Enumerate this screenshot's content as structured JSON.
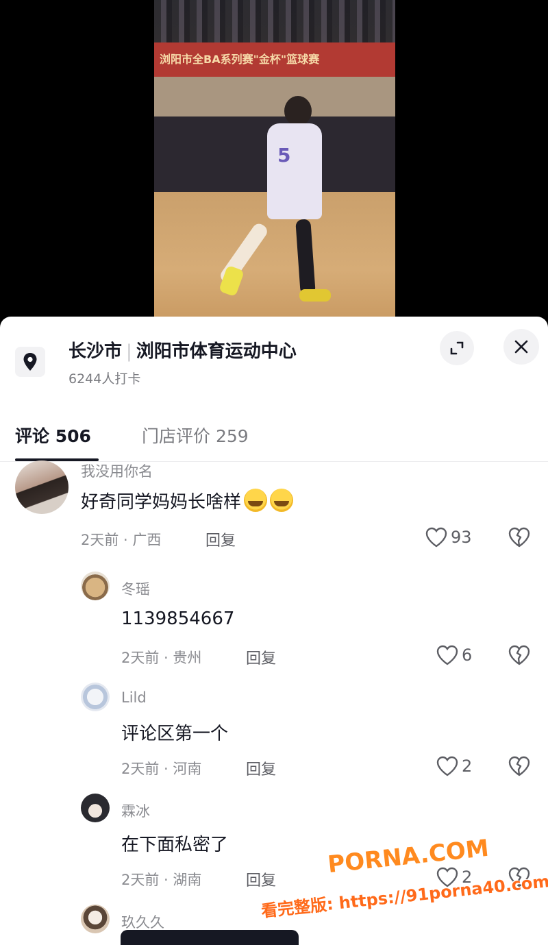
{
  "video": {
    "banner_text": "浏阳市全BA系列赛\"金杯\"篮球赛",
    "jersey_number": "5"
  },
  "location": {
    "city": "长沙市",
    "venue": "浏阳市体育运动中心",
    "checkins": "6244人打卡",
    "icon": "location-pin-icon"
  },
  "tabs": [
    {
      "label": "评论 506",
      "active": true
    },
    {
      "label": "门店评价 259",
      "active": false
    }
  ],
  "comments": [
    {
      "username": "我没用你名",
      "text": "好奇同学妈妈长啥样",
      "emoji_count": 2,
      "time": "2天前",
      "region": "广西",
      "reply_label": "回复",
      "likes": "93",
      "avatar_color": "#b89a8a"
    },
    {
      "username": "冬瑶",
      "text": "1139854667",
      "time": "2天前",
      "region": "贵州",
      "reply_label": "回复",
      "likes": "6",
      "avatar_color": "#c8b090"
    },
    {
      "username": "Lild",
      "text": "评论区第一个",
      "time": "2天前",
      "region": "河南",
      "reply_label": "回复",
      "likes": "2",
      "avatar_color": "#cfd8e6"
    },
    {
      "username": "霖冰",
      "text": "在下面私密了",
      "time": "2天前",
      "region": "湖南",
      "reply_label": "回复",
      "likes": "2",
      "avatar_color": "#2a2a30"
    },
    {
      "username": "玖久久",
      "avatar_color": "#d9c6b2"
    }
  ],
  "watermark": {
    "brand": "PORNA.COM",
    "url": "看完整版: https://91porna40.com"
  }
}
